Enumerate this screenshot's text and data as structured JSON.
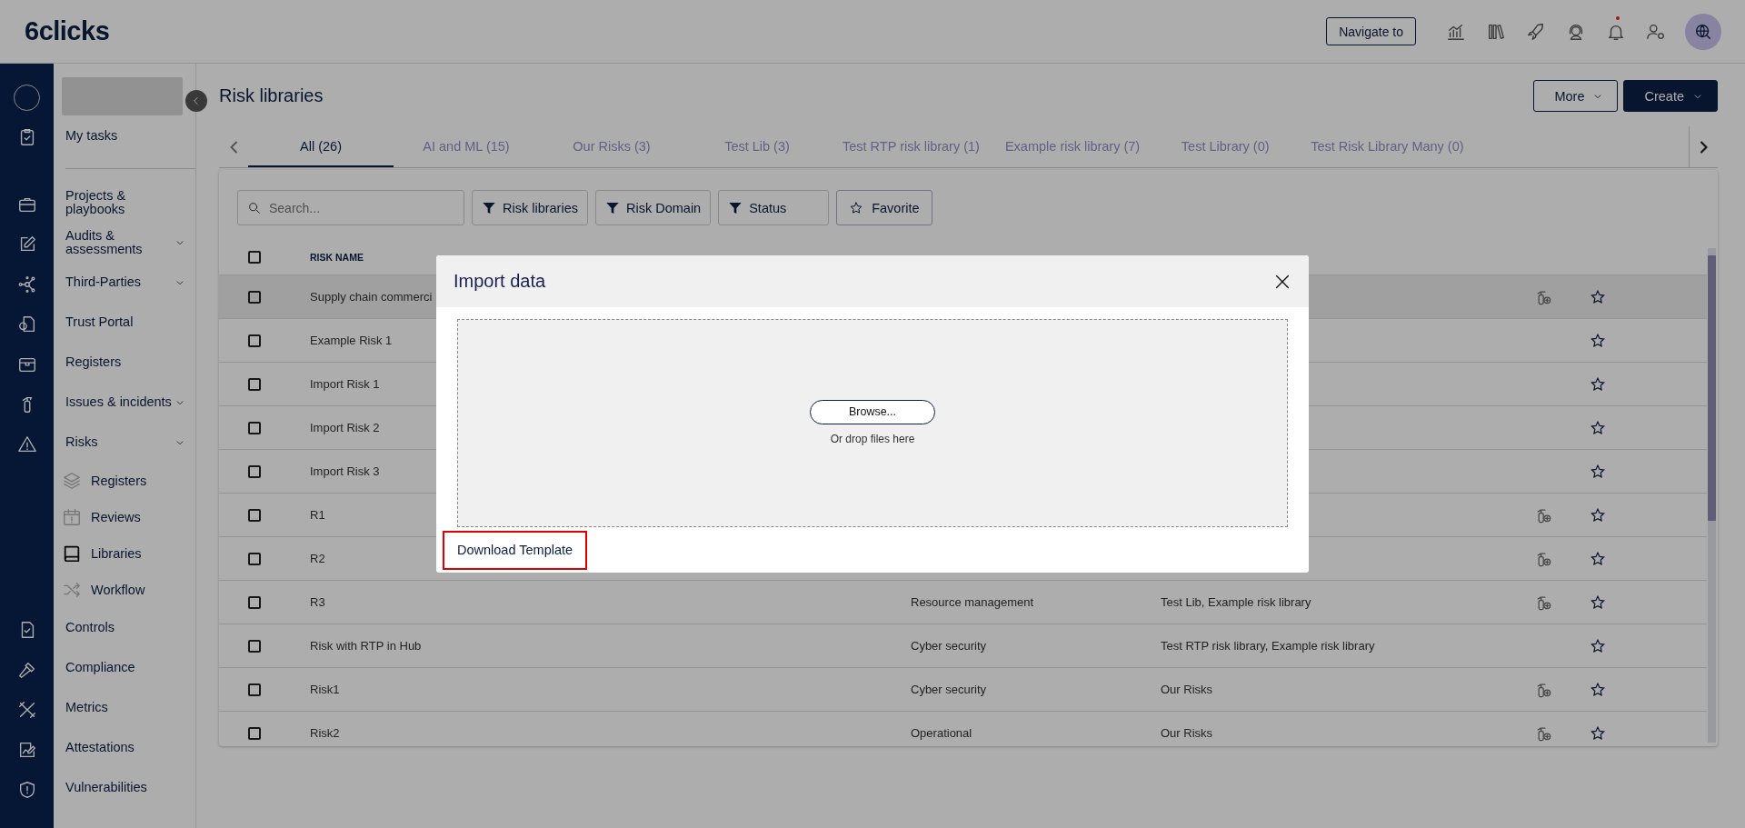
{
  "top_bar": {
    "logo": "6clicks",
    "navigate_button": "Navigate to",
    "notification_dot": true
  },
  "sidebar": {
    "my_tasks": "My tasks",
    "items": [
      {
        "label": "Projects & playbooks",
        "kind": "link"
      },
      {
        "label": "Audits & assessments",
        "kind": "group"
      },
      {
        "label": "Third-Parties",
        "kind": "group"
      },
      {
        "label": "Trust Portal",
        "kind": "link"
      },
      {
        "label": "Registers",
        "kind": "link"
      },
      {
        "label": "Issues & incidents",
        "kind": "group"
      },
      {
        "label": "Risks",
        "kind": "group",
        "children": [
          {
            "label": "Registers",
            "selected": false
          },
          {
            "label": "Reviews",
            "selected": false
          },
          {
            "label": "Libraries",
            "selected": true
          },
          {
            "label": "Workflow",
            "selected": false
          }
        ]
      },
      {
        "label": "Controls",
        "kind": "link"
      },
      {
        "label": "Compliance",
        "kind": "link"
      },
      {
        "label": "Metrics",
        "kind": "link"
      },
      {
        "label": "Attestations",
        "kind": "link"
      },
      {
        "label": "Vulnerabilities",
        "kind": "link"
      }
    ]
  },
  "page": {
    "title": "Risk libraries",
    "buttons": [
      {
        "label": "More",
        "kind": "outline"
      },
      {
        "label": "Create",
        "kind": "primary"
      }
    ]
  },
  "tabs": [
    {
      "label": "All (26)",
      "selected": true
    },
    {
      "label": "AI and ML (15)",
      "selected": false
    },
    {
      "label": "Our Risks (3)",
      "selected": false
    },
    {
      "label": "Test Lib (3)",
      "selected": false
    },
    {
      "label": "Test RTP risk library (1)",
      "selected": false
    },
    {
      "label": "Example risk library (7)",
      "selected": false
    },
    {
      "label": "Test Library (0)",
      "selected": false
    },
    {
      "label": "Test Risk Library Many (0)",
      "selected": false
    }
  ],
  "filters": {
    "search": {
      "placeholder": "Search..."
    },
    "buttons": [
      {
        "label": "Risk libraries",
        "kind": "filter"
      },
      {
        "label": "Risk Domain",
        "kind": "filter"
      },
      {
        "label": "Status",
        "kind": "filter"
      },
      {
        "label": "Favorite",
        "kind": "favorite"
      }
    ]
  },
  "table": {
    "select_all_checked": false,
    "columns": [
      "RISK NAME"
    ],
    "rows": [
      {
        "name": "Supply chain commerci",
        "highlighted": true,
        "checked": false,
        "favorite": false,
        "action_icon": true
      },
      {
        "name": "Example Risk 1",
        "highlighted": false,
        "checked": false,
        "favorite": false,
        "action_icon": false
      },
      {
        "name": "Import Risk 1",
        "highlighted": false,
        "checked": false,
        "favorite": false,
        "action_icon": false
      },
      {
        "name": "Import Risk 2",
        "highlighted": false,
        "checked": false,
        "favorite": false,
        "action_icon": false
      },
      {
        "name": "Import Risk 3",
        "highlighted": false,
        "checked": false,
        "favorite": false,
        "action_icon": false
      },
      {
        "name": "R1",
        "highlighted": false,
        "checked": false,
        "favorite": false,
        "action_icon": true
      },
      {
        "name": "R2",
        "highlighted": false,
        "checked": false,
        "favorite": false,
        "action_icon": true
      },
      {
        "name": "R3",
        "domain": "Resource management",
        "libraries": "Test Lib, Example risk library",
        "highlighted": false,
        "checked": false,
        "favorite": false,
        "action_icon": true
      },
      {
        "name": "Risk with RTP in Hub",
        "domain": "Cyber security",
        "libraries": "Test RTP risk library, Example risk library",
        "highlighted": false,
        "checked": false,
        "favorite": false,
        "action_icon": false
      },
      {
        "name": "Risk1",
        "domain": "Cyber security",
        "libraries": "Our Risks",
        "highlighted": false,
        "checked": false,
        "favorite": false,
        "action_icon": true
      },
      {
        "name": "Risk2",
        "domain": "Operational",
        "libraries": "Our Risks",
        "highlighted": false,
        "checked": false,
        "favorite": false,
        "action_icon": true
      }
    ]
  },
  "modal": {
    "title": "Import data",
    "browse_button": "Browse...",
    "drop_hint": "Or drop files here",
    "download_link": "Download Template"
  }
}
